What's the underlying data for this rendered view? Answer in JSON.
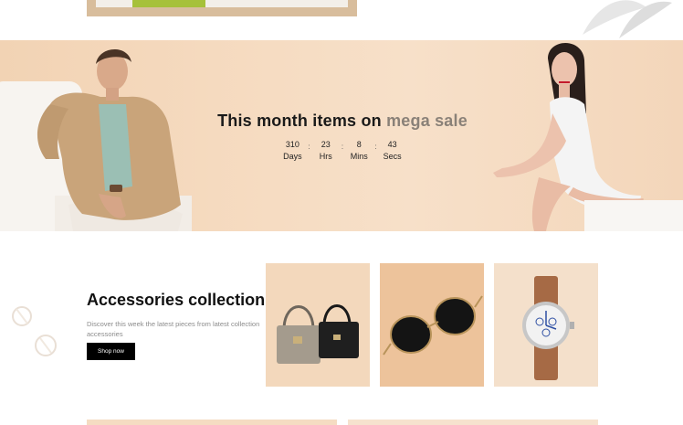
{
  "sale_banner": {
    "title_main": "This month items on",
    "title_accent": "mega sale",
    "countdown": [
      {
        "value": "310",
        "unit": "Days"
      },
      {
        "value": "23",
        "unit": "Hrs"
      },
      {
        "value": "8",
        "unit": "Mins"
      },
      {
        "value": "43",
        "unit": "Secs"
      }
    ],
    "separator": ":"
  },
  "accessories": {
    "title": "Accessories collection",
    "description": "Discover this week the latest pieces from latest collection accessories",
    "button_label": "Shop now"
  },
  "colors": {
    "banner_bg": "#f4d8bc",
    "accent_text": "#8a8178",
    "button_bg": "#000000",
    "button_text": "#ffffff"
  }
}
